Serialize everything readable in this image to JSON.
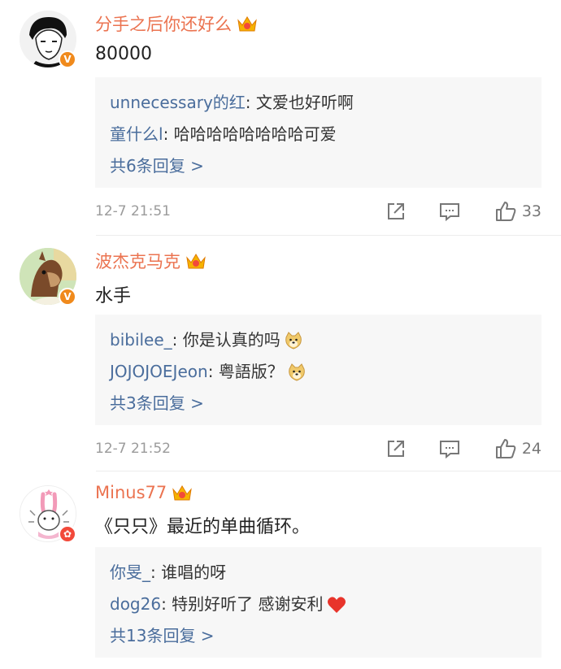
{
  "comments": [
    {
      "username": "分手之后你还好么",
      "content": "80000",
      "replies": [
        {
          "name": "unnecessary的红",
          "text": ": 文爱也好听啊"
        },
        {
          "name": "童什么l",
          "text": ": 哈哈哈哈哈哈哈哈可爱"
        }
      ],
      "more": "共6条回复 >",
      "time": "12-7 21:51",
      "likes": "33"
    },
    {
      "username": "波杰克马克",
      "content": "水手",
      "replies": [
        {
          "name": "bibilee_",
          "text": ": 你是认真的吗"
        },
        {
          "name": "JOJOJOEJeon",
          "text": ": 粤語版？"
        }
      ],
      "more": "共3条回复 >",
      "time": "12-7 21:52",
      "likes": "24"
    },
    {
      "username": "Minus77",
      "content": "《只只》最近的单曲循环。",
      "replies": [
        {
          "name": "你旻_",
          "text": ": 谁唱的呀"
        },
        {
          "name": "dog26",
          "text": ": 特别好听了 感谢安利"
        }
      ],
      "more": "共13条回复 >"
    }
  ],
  "colors": {
    "username": "#eb7350",
    "reply_name": "#4a6d9c",
    "reply_bg": "#f7f7f7",
    "meta": "#9b9b9b"
  },
  "icons": {
    "badge_verified": "v-badge-icon",
    "crown": "crown-icon",
    "share": "share-icon",
    "comment": "comment-icon",
    "like": "thumbs-up-icon",
    "doge": "doge-emoji-icon",
    "heart": "heart-emoji-icon"
  }
}
